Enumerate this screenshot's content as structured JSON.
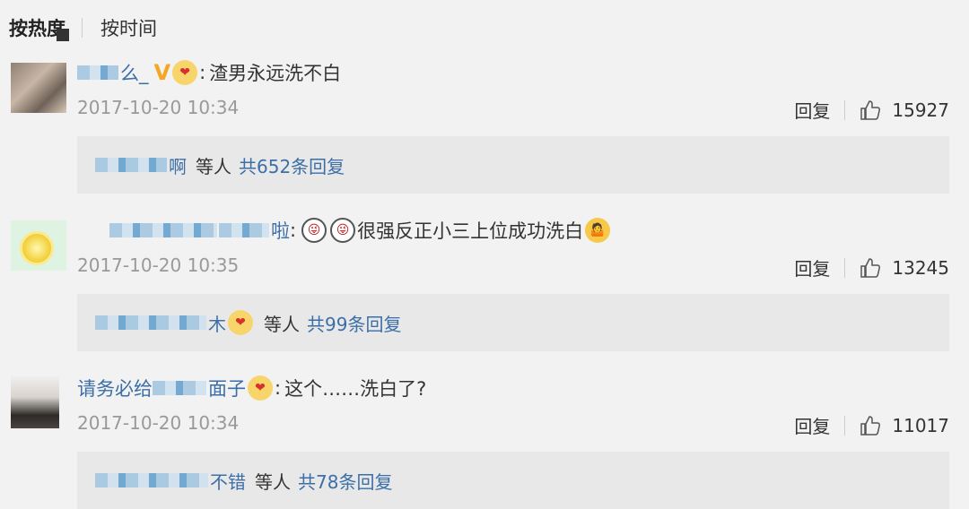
{
  "sort": {
    "hot": "按热度",
    "time": "按时间"
  },
  "comments": [
    {
      "name_suffix": "么_",
      "vip": "V",
      "text": "渣男永远洗不白",
      "time": "2017-10-20 10:34",
      "reply": "回复",
      "likes": "15927",
      "sub_users": "啊",
      "sub_etc": "等人",
      "sub_count": "共652条回复"
    },
    {
      "name_suffix": "啦",
      "text": "很强反正小三上位成功洗白",
      "time": "2017-10-20 10:35",
      "reply": "回复",
      "likes": "13245",
      "sub_users": "木",
      "sub_etc": "等人",
      "sub_count": "共99条回复"
    },
    {
      "name_prefix": "请务必给",
      "name_suffix": "面子",
      "text": "这个……洗白了?",
      "time": "2017-10-20 10:34",
      "reply": "回复",
      "likes": "11017",
      "sub_users": "不错",
      "sub_etc": "等人",
      "sub_count": "共78条回复"
    }
  ]
}
